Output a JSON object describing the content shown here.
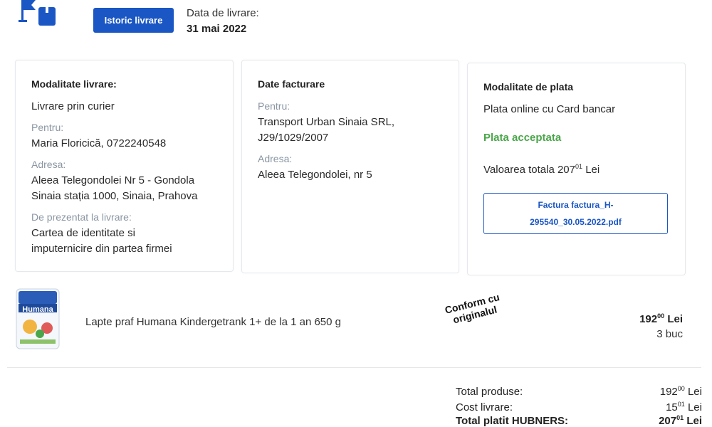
{
  "header": {
    "history_button": "Istoric livrare",
    "delivery_date_label": "Data de livrare:",
    "delivery_date": "31 mai 2022"
  },
  "delivery_card": {
    "title": "Modalitate livrare:",
    "method": "Livrare prin curier",
    "for_label": "Pentru:",
    "for_value": "Maria Floricică, 0722240548",
    "address_label": "Adresa:",
    "address_line1": "Aleea Telegondolei Nr 5 - Gondola",
    "address_line2": "Sinaia stația 1000, Sinaia, Prahova",
    "present_label": "De prezentat la livrare:",
    "present_line1": "Cartea de identitate si",
    "present_line2": "imputernicire din partea firmei"
  },
  "billing_card": {
    "title": "Date facturare",
    "for_label": "Pentru:",
    "for_line1": "Transport Urban Sinaia SRL,",
    "for_line2": "J29/1029/2007",
    "address_label": "Adresa:",
    "address_value": "Aleea Telegondolei, nr 5"
  },
  "payment_card": {
    "title": "Modalitate de plata",
    "method": "Plata online cu Card bancar",
    "status": "Plata acceptata",
    "total_text": "Valoarea totala 207",
    "total_decimals": "01",
    "total_currency": "Lei",
    "invoice_line1": "Factura factura_H-",
    "invoice_line2": "295540_30.05.2022.pdf"
  },
  "product": {
    "name": "Lapte praf Humana Kindergetrank 1+ de la 1 an 650 g",
    "image_brand": "Humana",
    "price_int": "192",
    "price_dec": "00",
    "currency": "Lei",
    "quantity": "3 buc",
    "stamp_line1": "Conform cu",
    "stamp_line2": "originalul"
  },
  "totals": {
    "products_label": "Total produse:",
    "products_int": "192",
    "products_dec": "00",
    "delivery_label": "Cost livrare:",
    "delivery_int": "15",
    "delivery_dec": "01",
    "paid_label": "Total platit HUBNERS:",
    "paid_int": "207",
    "paid_dec": "01",
    "currency": "Lei"
  },
  "colors": {
    "primary": "#1a56c4",
    "success": "#4aa64a",
    "muted_label": "#8a96a3"
  }
}
